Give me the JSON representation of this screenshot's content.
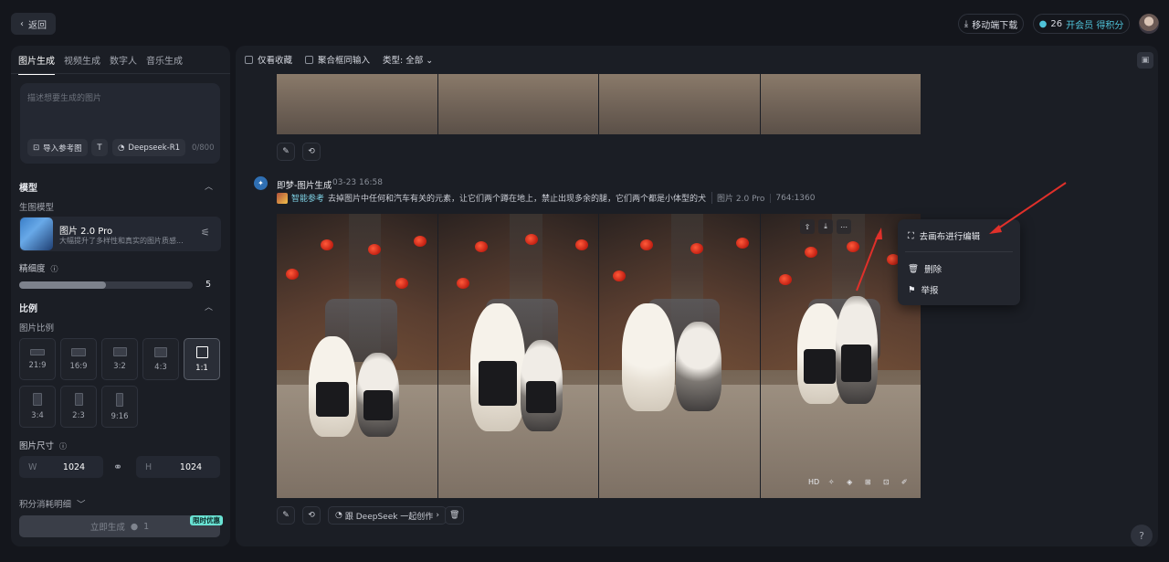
{
  "topbar": {
    "back_label": "返回",
    "download_label": "移动端下载",
    "credits": "26",
    "vip_label": "开会员 得积分"
  },
  "left": {
    "tabs": [
      "图片生成",
      "视频生成",
      "数字人",
      "音乐生成"
    ],
    "prompt_placeholder": "描述想要生成的图片",
    "import_ref_label": "导入参考图",
    "deepseek_label": "Deepseek-R1",
    "char_count": "0/800",
    "model_section": "模型",
    "model_sub": "生图模型",
    "model_name": "图片 2.0 Pro",
    "model_desc": "大幅提升了多样性和真实的图片质感...",
    "detail_label": "精细度",
    "detail_value": "5",
    "detail_fraction": 0.5,
    "ratio_section": "比例",
    "ratio_sub": "图片比例",
    "ratios": [
      "21:9",
      "16:9",
      "3:2",
      "4:3",
      "1:1",
      "3:4",
      "2:3",
      "9:16"
    ],
    "active_ratio": "1:1",
    "size_label": "图片尺寸",
    "width_key": "W",
    "width_value": "1024",
    "height_key": "H",
    "height_value": "1024",
    "cost_label": "积分消耗明细",
    "generate_label": "立即生成",
    "generate_cost": "1",
    "promo_label": "限时优惠"
  },
  "main": {
    "filter_favorites": "仅看收藏",
    "filter_aggregate": "聚合框同输入",
    "filter_type": "类型: 全部",
    "gen_title": "即梦-图片生成",
    "gen_time": "03-23  16:58",
    "smart_ref": "智能参考",
    "prompt_text": "去掉图片中任何和汽车有关的元素，让它们两个蹲在地上，禁止出现多余的腿，它们两个都是小体型的犬",
    "model_tag": "图片 2.0 Pro",
    "size_tag": "764:1360",
    "deepseek_btn": "跟 DeepSeek 一起创作",
    "hd_label": "HD"
  },
  "menu": {
    "edit_canvas": "去画布进行编辑",
    "delete": "删除",
    "report": "举报"
  },
  "colors": {
    "accent": "#4fc3d9",
    "promo": "#6ae3d4",
    "arrow": "#e0302a"
  }
}
